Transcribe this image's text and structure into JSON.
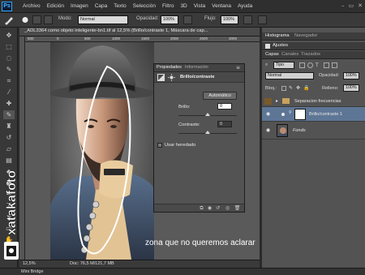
{
  "app": {
    "logo": "Ps"
  },
  "menu": [
    "Archivo",
    "Edición",
    "Imagen",
    "Capa",
    "Texto",
    "Selección",
    "Filtro",
    "3D",
    "Vista",
    "Ventana",
    "Ayuda"
  ],
  "window_controls": [
    "–",
    "▭",
    "✕"
  ],
  "options": {
    "modo_label": "Modo:",
    "modo_value": "Normal",
    "opacidad_label": "Opacidad:",
    "opacidad_value": "100%",
    "flujo_label": "Flujo:",
    "flujo_value": "100%"
  },
  "document": {
    "tab_title": "_ADL3364 como objeto inteligente-bn1.tif al 12,5% (Brillo/contraste 1, Máscara de cap...",
    "ruler_ticks": [
      "500",
      "0",
      "500",
      "1000",
      "1500",
      "2000",
      "2500",
      "3000"
    ],
    "zoom": "12,5%",
    "doc_info": "Doc: 76,5 M/121,7 MB"
  },
  "mini_bridge": "Mini Bridge",
  "properties": {
    "tabs": [
      "Propiedades",
      "Información"
    ],
    "title": "Brillo/contraste",
    "auto_button": "Automático",
    "brillo_label": "Brillo:",
    "brillo_value": "0",
    "contraste_label": "Contraste:",
    "contraste_value": "0",
    "legacy_label": "Usar heredado",
    "brillo_level": 0.5,
    "contraste_level": 0.5
  },
  "dock": {
    "top_tabs": [
      "Histograma",
      "Navegador"
    ],
    "ajustes_tab": "Ajustes",
    "layers_tabs": [
      "Capas",
      "Canales",
      "Trazados"
    ],
    "kind_filter": "Tipo",
    "blend_mode": "Normal",
    "opacidad_label": "Opacidad:",
    "opacidad_value": "100%",
    "bloq_label": "Bloq.:",
    "relleno_label": "Relleno:",
    "relleno_value": "100%",
    "layers": [
      {
        "name": "Separacion frecuencias",
        "kind": "group"
      },
      {
        "name": "Brillo/contraste 1",
        "kind": "adjustment"
      },
      {
        "name": "Fondo",
        "kind": "background"
      }
    ]
  },
  "annotation": {
    "text": "zona que no queremos aclarar"
  },
  "watermark": {
    "text": "xatakafoto"
  },
  "colors": {
    "accent_blue": "#30a8ff",
    "selected_layer": "#5e7696",
    "annotation": "#ffffff"
  }
}
